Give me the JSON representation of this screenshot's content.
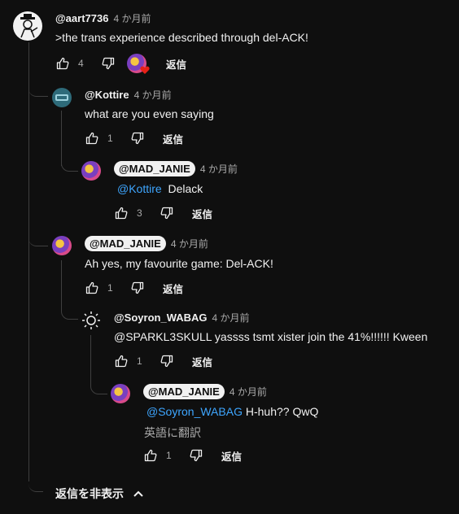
{
  "comments": [
    {
      "author": "@aart7736",
      "time": "4 か月前",
      "text": ">the trans experience described through del-ACK!",
      "likes": "4",
      "reply": "返信"
    },
    {
      "author": "@Kottire",
      "time": "4 か月前",
      "text": "what are you even saying",
      "likes": "1",
      "reply": "返信"
    },
    {
      "author": "@MAD_JANIE",
      "time": "4 か月前",
      "mention": "@Kottire",
      "text": "Delack",
      "likes": "3",
      "reply": "返信"
    },
    {
      "author": "@MAD_JANIE",
      "time": "4 か月前",
      "text": "Ah yes, my favourite game: Del-ACK!",
      "likes": "1",
      "reply": "返信"
    },
    {
      "author": "@Soyron_WABAG",
      "time": "4 か月前",
      "text": "@SPARKL3SKULL yassss tsmt xister join the 41%!!!!!! Kween",
      "likes": "1",
      "reply": "返信"
    },
    {
      "author": "@MAD_JANIE",
      "time": "4 か月前",
      "mention": "@Soyron_WABAG",
      "text": "H-huh?? QwQ",
      "translate": "英語に翻訳",
      "likes": "1",
      "reply": "返信"
    }
  ],
  "hide_replies_label": "返信を非表示",
  "colors": {
    "background": "#0f0f0f",
    "mention": "#3ea6ff",
    "heart": "#e62117",
    "thread_line": "#3f3f3f"
  }
}
